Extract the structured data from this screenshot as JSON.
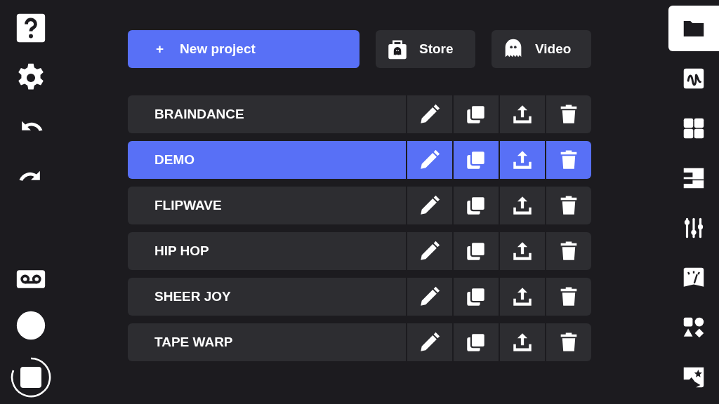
{
  "new_project_button": {
    "icon": "+",
    "label": "New project"
  },
  "header_buttons": [
    {
      "kind": "store",
      "label": "Store"
    },
    {
      "kind": "video",
      "label": "Video"
    }
  ],
  "projects": [
    {
      "name": "BRAINDANCE",
      "selected": false
    },
    {
      "name": "DEMO",
      "selected": true
    },
    {
      "name": "FLIPWAVE",
      "selected": false
    },
    {
      "name": "HIP HOP",
      "selected": false
    },
    {
      "name": "SHEER JOY",
      "selected": false
    },
    {
      "name": "TAPE WARP",
      "selected": false
    }
  ],
  "right_nav": [
    {
      "kind": "projects",
      "selected": true
    },
    {
      "kind": "wave",
      "selected": false
    },
    {
      "kind": "pads",
      "selected": false
    },
    {
      "kind": "keys",
      "selected": false
    },
    {
      "kind": "mixer",
      "selected": false
    },
    {
      "kind": "meter",
      "selected": false
    },
    {
      "kind": "shapes",
      "selected": false
    },
    {
      "kind": "sticker",
      "selected": false
    }
  ]
}
